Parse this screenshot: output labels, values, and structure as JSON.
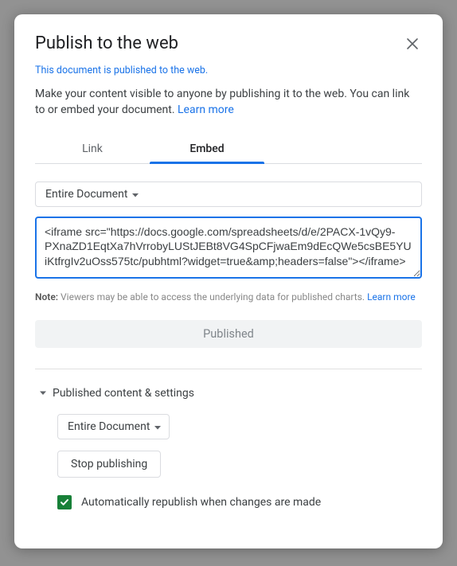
{
  "dialog": {
    "title": "Publish to the web",
    "status": "This document is published to the web.",
    "description_prefix": "Make your content visible to anyone by publishing it to the web. You can link to or embed your document. ",
    "learn_more": "Learn more"
  },
  "tabs": {
    "link": "Link",
    "embed": "Embed"
  },
  "embed": {
    "scope_label": "Entire Document",
    "code": "<iframe src=\"https://docs.google.com/spreadsheets/d/e/2PACX-1vQy9-PXnaZD1EqtXa7hVrrobyLUStJEBt8VG4SpCFjwaEm9dEcQWe5csBE5YUiKtfrgIv2uOss575tc/pubhtml?widget=true&amp;headers=false\"></iframe>"
  },
  "note": {
    "label": "Note:",
    "text": " Viewers may be able to access the underlying data for published charts. ",
    "learn_more": "Learn more"
  },
  "buttons": {
    "published": "Published",
    "stop_publishing": "Stop publishing"
  },
  "settings": {
    "header": "Published content & settings",
    "scope_label": "Entire Document",
    "auto_republish": "Automatically republish when changes are made",
    "auto_republish_checked": true
  }
}
